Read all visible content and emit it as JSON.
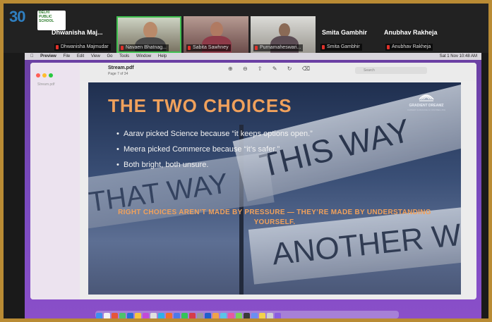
{
  "participants": [
    {
      "tile_name": "Dhwanisha  Maj...",
      "badge": "Dhwanisha Majmudar"
    },
    {
      "tile_name": "",
      "badge": "Navaen Bhatnag..."
    },
    {
      "tile_name": "",
      "badge": "Sabita Sawhney"
    },
    {
      "tile_name": "",
      "badge": "Purnamaheswari..."
    },
    {
      "tile_name": "Smita Gambhir",
      "badge": "Smita Gambhir"
    },
    {
      "tile_name": "Anubhav Rakheja",
      "badge": "Anubhav Rakheja"
    }
  ],
  "mac_menu": {
    "items": [
      "Preview",
      "File",
      "Edit",
      "View",
      "Go",
      "Tools",
      "Window",
      "Help"
    ],
    "clock": "Sat 1 Nov 10:48 AM"
  },
  "preview": {
    "file_title": "Stream.pdf",
    "page_info": "Page 7 of 34",
    "tools": [
      "⊕",
      "⊖",
      "⇧",
      "✎",
      "↻",
      "⌫"
    ],
    "search_placeholder": "Search",
    "sidebar_thumb": "Stream.pdf"
  },
  "slide": {
    "title": "THE TWO CHOICES",
    "bullets": [
      "Aarav picked Science because “it keeps options open.”",
      "Meera picked Commerce because “it’s safer.”",
      "Both bright, both unsure."
    ],
    "tagline": "RIGHT CHOICES AREN’T MADE BY PRESSURE — THEY’RE MADE BY UNDERSTANDING YOURSELF.",
    "sign_texts": [
      "THIS WAY",
      "THAT WAY",
      "ANOTHER WAY"
    ],
    "brand_name": "GRADIENT DREAMZ",
    "brand_tag": "CAREER GUIDANCE & COUNSELLING"
  },
  "logo": {
    "number": "30",
    "school": [
      "DELHI",
      "PUBLIC",
      "SCHOOL"
    ]
  },
  "colors": {
    "accent": "#f0a15c",
    "frame": "#b98b34"
  }
}
